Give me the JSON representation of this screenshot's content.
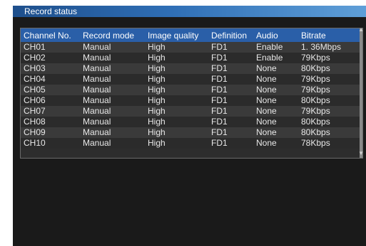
{
  "window": {
    "title": "Record status"
  },
  "table": {
    "headers": [
      "Channel No.",
      "Record mode",
      "Image quality",
      "Definition",
      "Audio",
      "Bitrate"
    ],
    "rows": [
      [
        "CH01",
        "Manual",
        "High",
        "FD1",
        "Enable",
        "1. 36Mbps"
      ],
      [
        "CH02",
        "Manual",
        "High",
        "FD1",
        "Enable",
        "79Kbps"
      ],
      [
        "CH03",
        "Manual",
        "High",
        "FD1",
        "None",
        "80Kbps"
      ],
      [
        "CH04",
        "Manual",
        "High",
        "FD1",
        "None",
        "79Kbps"
      ],
      [
        "CH05",
        "Manual",
        "High",
        "FD1",
        "None",
        "79Kbps"
      ],
      [
        "CH06",
        "Manual",
        "High",
        "FD1",
        "None",
        "80Kbps"
      ],
      [
        "CH07",
        "Manual",
        "High",
        "FD1",
        "None",
        "79Kbps"
      ],
      [
        "CH08",
        "Manual",
        "High",
        "FD1",
        "None",
        "80Kbps"
      ],
      [
        "CH09",
        "Manual",
        "High",
        "FD1",
        "None",
        "80Kbps"
      ],
      [
        "CH10",
        "Manual",
        "High",
        "FD1",
        "None",
        "78Kbps"
      ]
    ]
  },
  "icons": {
    "scroll_up": "arrow-up-icon",
    "scroll_down": "arrow-down-icon"
  }
}
